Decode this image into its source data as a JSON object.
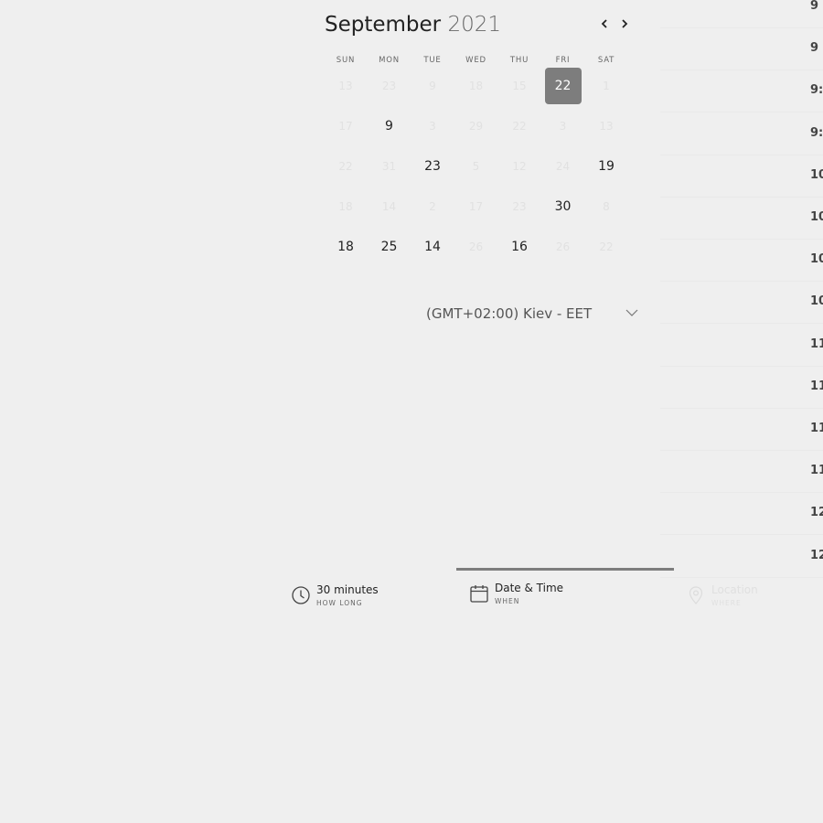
{
  "calendar": {
    "month": "September",
    "year": "2021",
    "prev_icon": "chevron-left-icon",
    "next_icon": "chevron-right-icon",
    "weekdays": [
      "SUN",
      "MON",
      "TUE",
      "WED",
      "THU",
      "FRI",
      "SAT"
    ],
    "weeks": [
      [
        {
          "d": "13",
          "m": true
        },
        {
          "d": "23",
          "m": true
        },
        {
          "d": "9",
          "m": true
        },
        {
          "d": "18",
          "m": true
        },
        {
          "d": "15",
          "m": true
        },
        {
          "d": "22",
          "s": true
        },
        {
          "d": "1",
          "m": true
        }
      ],
      [
        {
          "d": "17",
          "m": true
        },
        {
          "d": "9"
        },
        {
          "d": "3",
          "m": true
        },
        {
          "d": "29",
          "m": true
        },
        {
          "d": "22",
          "m": true
        },
        {
          "d": "3",
          "m": true
        },
        {
          "d": "13",
          "m": true
        }
      ],
      [
        {
          "d": "22",
          "m": true
        },
        {
          "d": "31",
          "m": true
        },
        {
          "d": "23"
        },
        {
          "d": "5",
          "m": true
        },
        {
          "d": "12",
          "m": true
        },
        {
          "d": "24",
          "m": true
        },
        {
          "d": "19"
        }
      ],
      [
        {
          "d": "18",
          "m": true
        },
        {
          "d": "14",
          "m": true
        },
        {
          "d": "2",
          "m": true
        },
        {
          "d": "17",
          "m": true
        },
        {
          "d": "23",
          "m": true
        },
        {
          "d": "30"
        },
        {
          "d": "8",
          "m": true
        }
      ],
      [
        {
          "d": "18"
        },
        {
          "d": "25"
        },
        {
          "d": "14"
        },
        {
          "d": "26",
          "m": true
        },
        {
          "d": "16"
        },
        {
          "d": "26",
          "m": true
        },
        {
          "d": "22",
          "m": true
        }
      ]
    ],
    "selected_color": "#7d7d7d"
  },
  "timezone": {
    "label": "(GMT+02:00) Kiev - EET",
    "icon": "chevron-down-icon"
  },
  "times": [
    "9",
    "9",
    "9:",
    "9:",
    "10",
    "10",
    "10",
    "10",
    "11",
    "11",
    "11",
    "11",
    "12",
    "12"
  ],
  "steps": [
    {
      "title": "30 minutes",
      "sub": "HOW LONG",
      "icon": "clock-icon",
      "state": "done"
    },
    {
      "title": "Date & Time",
      "sub": "WHEN",
      "icon": "calendar-icon",
      "state": "active"
    },
    {
      "title": "Location",
      "sub": "WHERE",
      "icon": "location-pin-icon",
      "state": "disabled"
    }
  ]
}
